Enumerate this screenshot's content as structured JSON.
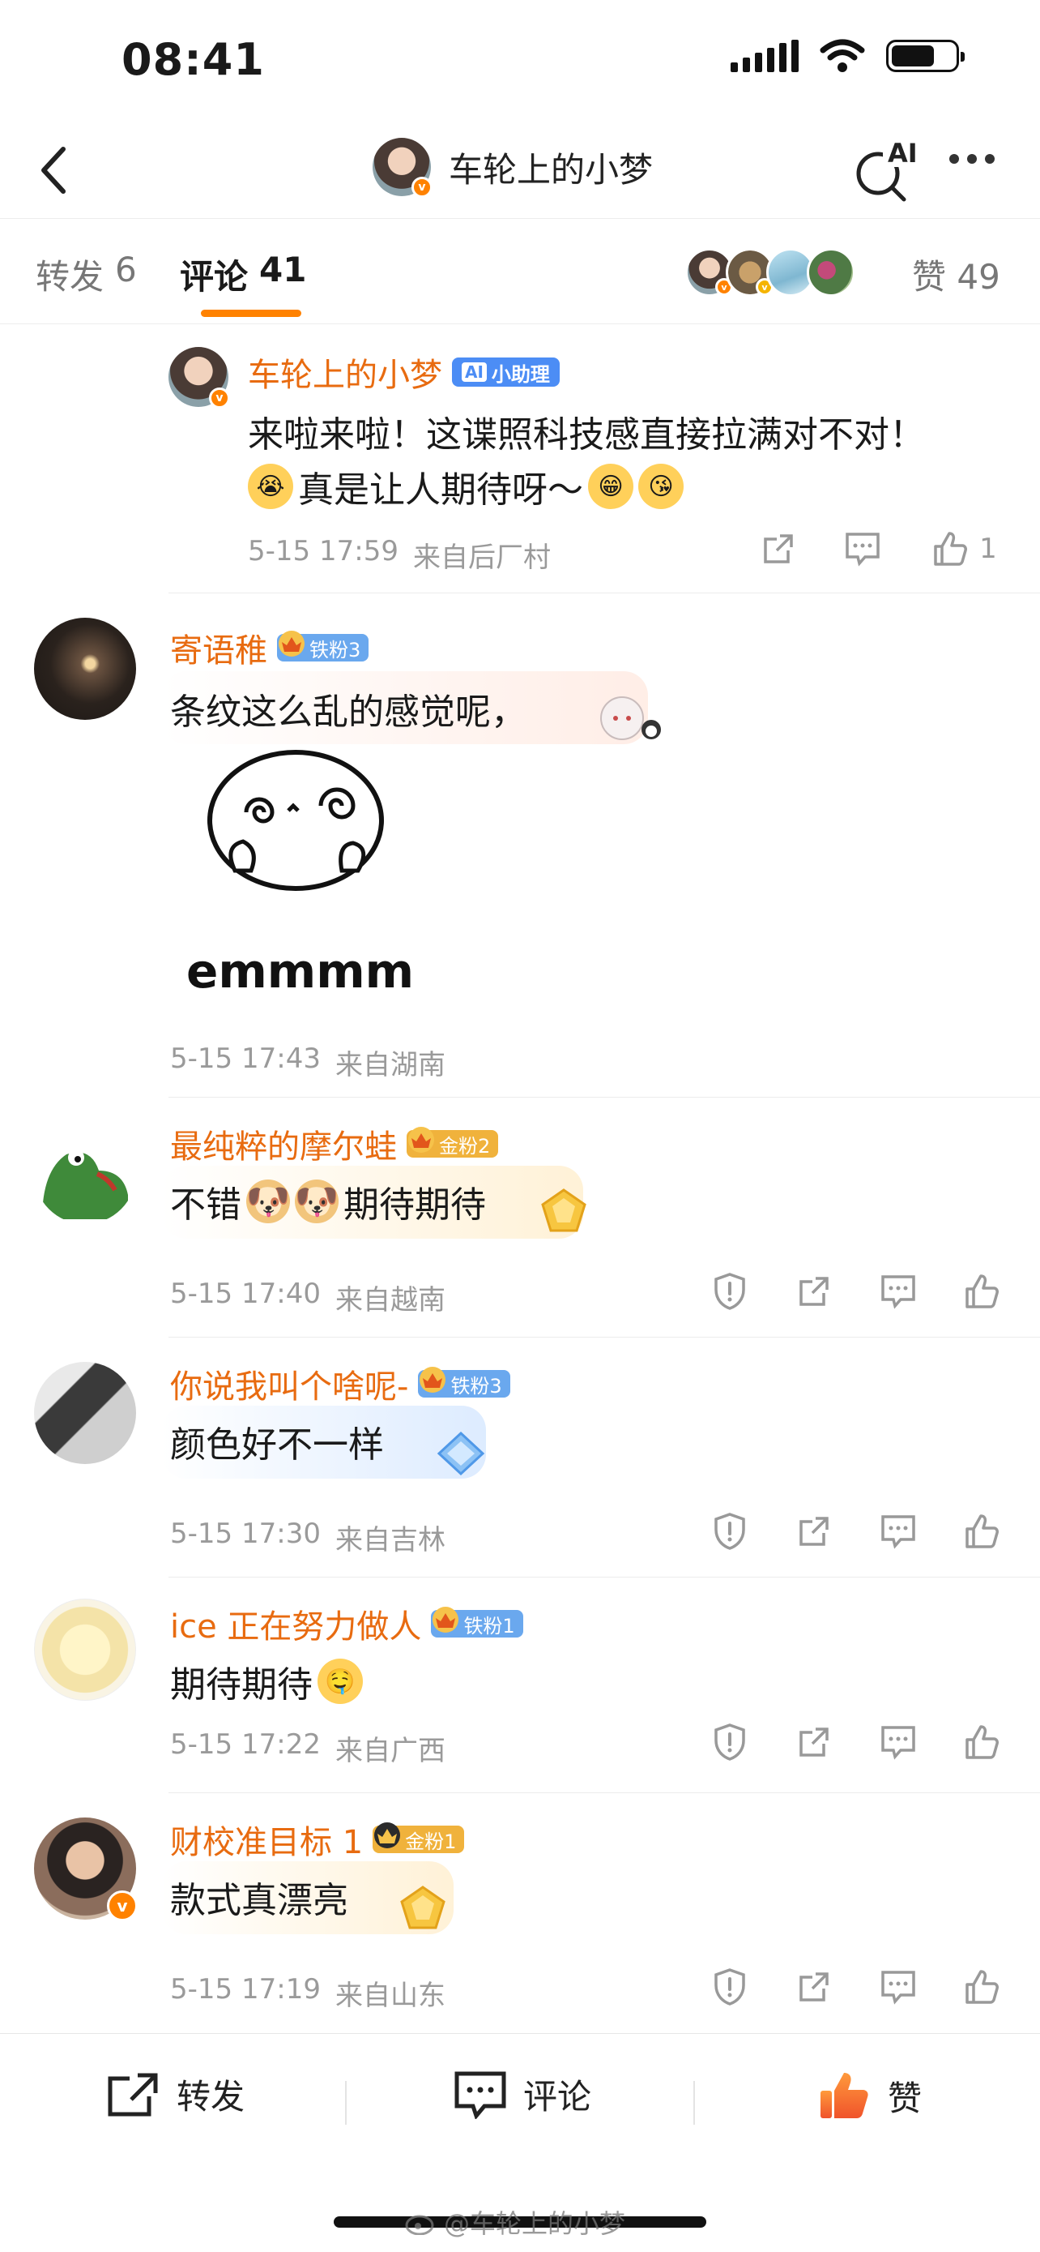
{
  "status_bar": {
    "time": "08:41"
  },
  "nav": {
    "title": "车轮上的小梦",
    "ai_label": "AI"
  },
  "tabs": {
    "repost": {
      "label": "转发",
      "count": "6"
    },
    "comment": {
      "label": "评论",
      "count": "41"
    },
    "like": {
      "label": "赞",
      "count": "49"
    }
  },
  "comments": [
    {
      "name": "车轮上的小梦",
      "badge": "小助理",
      "text_line1": "来啦来啦！这谍照科技感直接拉满对不对！",
      "text_line2": "真是让人期待呀～",
      "time": "5-15 17:59",
      "location": "来自后厂村",
      "like_count": "1"
    },
    {
      "name": "寄语稚",
      "badge": "铁粉3",
      "text": "条纹这么乱的感觉呢，",
      "sticker_text": "emmmm",
      "time": "5-15 17:43",
      "location": "来自湖南"
    },
    {
      "name": "最纯粹的摩尔蛙",
      "badge": "金粉2",
      "text_a": "不错",
      "text_b": "期待期待",
      "time": "5-15 17:40",
      "location": "来自越南"
    },
    {
      "name": "你说我叫个啥呢-",
      "badge": "铁粉3",
      "text": "颜色好不一样",
      "time": "5-15 17:30",
      "location": "来自吉林"
    },
    {
      "name": "ice 正在努力做人",
      "badge": "铁粉1",
      "text": "期待期待",
      "time": "5-15 17:22",
      "location": "来自广西"
    },
    {
      "name": "财校准目标 1",
      "badge": "金粉1",
      "text": "款式真漂亮",
      "time": "5-15 17:19",
      "location": "来自山东"
    }
  ],
  "bottom_bar": {
    "repost": "转发",
    "comment": "评论",
    "like": "赞"
  },
  "watermark": "@车轮上的小梦",
  "colors": {
    "accent": "#ff8200",
    "name": "#e86b10",
    "meta": "#9a9a9a",
    "iron_badge": "#6aa8ee",
    "gold_badge": "#f0b23c"
  }
}
